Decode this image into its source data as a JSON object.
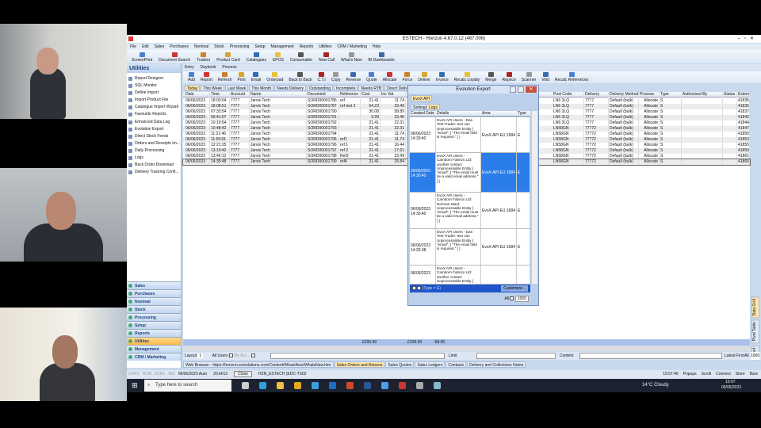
{
  "app": {
    "title": "ESTECH - Horizon 4.67.0.12 (467.006)"
  },
  "menu": [
    "File",
    "Edit",
    "Sales",
    "Purchases",
    "Nominal",
    "Stock",
    "Processing",
    "Setup",
    "Management",
    "Reports",
    "Utilities",
    "CRM / Marketing",
    "Help"
  ],
  "quickbar": [
    "ScreenPrint",
    "Document Search",
    "Traders",
    "Product Card",
    "Catalogues",
    "EPOS",
    "Consumable",
    "New Call",
    "What's New",
    "BI Dashboards"
  ],
  "subtabs": [
    "Entry",
    "Daybook",
    "Process"
  ],
  "actions": [
    "Add",
    "Report",
    "Refresh",
    "Print",
    "Email",
    "Orderpad",
    "Back to Back",
    "C.T.I",
    "Copy",
    "Reverse",
    "Quote",
    "Allocate",
    "Force",
    "Deliver",
    "Invoice",
    "Recalc Loyalty",
    "Merge",
    "Reprice",
    "Scanner",
    "Void",
    "Recalc References"
  ],
  "sidebar": {
    "title": "Utilities",
    "items": [
      "Report Designer",
      "SQL Monitor",
      "Define Import",
      "Import Product File",
      "Catalogue Import Wizard",
      "Favourite Reports",
      "Enhanced Data Log",
      "Evolution Export",
      "Direct Stock Feeds",
      "Orders and Receipts Im...",
      "Daily Processing",
      "Logs",
      "Back Order Download",
      "Delivery Tracking Confi..."
    ],
    "nav": [
      "Sales",
      "Purchases",
      "Nominal",
      "Stock",
      "Processing",
      "Setup",
      "Reports",
      "Utilities",
      "Management",
      "CRM / Marketing"
    ],
    "nav_selected": "Utilities"
  },
  "filters": [
    "Today",
    "This Week",
    "Last Week",
    "This Month",
    "Needs Delivery",
    "Outstanding",
    "Incomplete",
    "Needs RTB",
    "Direct Delivery O/S",
    "Search"
  ],
  "grid": {
    "left_columns": [
      "Date",
      "Time",
      "Account",
      "Name",
      "Document",
      "Reference",
      "Cost",
      "Inc Vat"
    ],
    "right_columns": [
      "Post Code",
      "Delivery",
      "Delivery Method",
      "Process",
      "Type",
      "Authorised By",
      "Status",
      "External I"
    ],
    "rows": [
      [
        "06/06/2023",
        "18:03:04",
        "7777",
        "Jarvis Tech",
        "SORD00001786",
        "ref",
        "21.41",
        "11.74",
        "LN6 3LQ",
        "7777",
        "Default (bulk)",
        "Allocate",
        "S",
        "",
        "",
        "4183571"
      ],
      [
        "06/06/2023",
        "18:08:51",
        "7777",
        "Jarvis Tech",
        "SORD00001787",
        "ref test 2",
        "64.23",
        "23.49",
        "LN6 3LQ",
        "7777",
        "Default (bulk)",
        "Allocate",
        "S",
        "",
        "",
        "4183577"
      ],
      [
        "06/06/2023",
        "07:33:54",
        "7777",
        "Jarvis Tech",
        "SORD00001790",
        "",
        "30.08",
        "58.89",
        "LN6 3LQ",
        "7777",
        "Default (bulk)",
        "Allocate",
        "S",
        "",
        "",
        "4183769"
      ],
      [
        "06/06/2023",
        "09:41:07",
        "7777",
        "Jarvis Tech",
        "SORD00001791",
        "",
        "9.99",
        "23.46",
        "LN6 3LQ",
        "7777",
        "Default (bulk)",
        "Allocate",
        "S",
        "",
        "",
        "4184243"
      ],
      [
        "06/06/2023",
        "10:16:54",
        "7777",
        "Jarvis Tech",
        "SORD00001792",
        "",
        "21.41",
        "22.31",
        "LN6 3LQ",
        "7777",
        "Default (bulk)",
        "Allocate",
        "S",
        "",
        "",
        "4184493"
      ],
      [
        "06/06/2023",
        "10:48:42",
        "7777",
        "Jarvis Tech",
        "SORD00001793",
        "",
        "21.41",
        "22.31",
        "LN58GN",
        "77772",
        "Default (bulk)",
        "Allocate",
        "S",
        "",
        "",
        "4184730"
      ],
      [
        "06/06/2023",
        "11:21:46",
        "7777",
        "Jarvis Tech",
        "SORD00001794",
        "",
        "21.41",
        "11.74",
        "LN58GN",
        "77772",
        "Default (bulk)",
        "Allocate",
        "S",
        "",
        "",
        "4185007"
      ],
      [
        "06/06/2023",
        "11:55:01",
        "7777",
        "Jarvis Tech",
        "SORD00001795",
        "ref1",
        "21.41",
        "11.74",
        "LN58GN",
        "77772",
        "Default (bulk)",
        "Allocate",
        "S",
        "",
        "",
        "4185317"
      ],
      [
        "06/06/2023",
        "12:21:25",
        "7777",
        "Jarvis Tech",
        "SORD00001796",
        "ref 1",
        "21.41",
        "16.44",
        "LN58GN",
        "77772",
        "Default (bulk)",
        "Allocate",
        "S",
        "",
        "",
        "4185525"
      ],
      [
        "06/06/2023",
        "13:10:42",
        "7777",
        "Jarvis Tech",
        "SORD00001797",
        "ref 2",
        "21.41",
        "17.61",
        "LN58GN",
        "77772",
        "Default (bulk)",
        "Allocate",
        "S",
        "",
        "",
        "4185935"
      ],
      [
        "06/06/2023",
        "13:46:12",
        "7777",
        "Jarvis Tech",
        "SORD00001798",
        "Ref3",
        "21.41",
        "23.49",
        "LN58GN",
        "77772",
        "Default (bulk)",
        "Allocate",
        "S",
        "",
        "",
        "4186151"
      ],
      [
        "06/06/2023",
        "14:35:48",
        "7777",
        "Jarvis Tech",
        "SORD00001799",
        "ref4",
        "21.41",
        "25.84",
        "LN58GN",
        "77772",
        "Default (bulk)",
        "Allocate",
        "S",
        "",
        "",
        "4186538"
      ]
    ],
    "totals": [
      "£296.99",
      "£228.99",
      "-68.00"
    ]
  },
  "dialog": {
    "title": "Evolution Export",
    "tab": "EvoX API",
    "subtabs": [
      "Settings",
      "Logs"
    ],
    "columns": [
      "Created Date",
      "Details",
      "Area",
      "Type"
    ],
    "rows": [
      {
        "date": "06/06/2023 14:30:40",
        "details": "EvoX API Users - Dan Test Trader: test can Unprocessable Entity { \"email\": [ \"The email field is required.\" ] }",
        "area": "EvoX API EU 1684",
        "type": "E"
      },
      {
        "date": "06/06/2023 14:30:40",
        "details": "EvoX API Users - Camborn Fabrics Ltd: another contact Unprocessable Entity { \"email\": [ \"The email must be a valid email address.\" ] }",
        "area": "EvoX API EU 1684",
        "type": "E"
      },
      {
        "date": "06/06/2023 14:30:40",
        "details": "EvoX API Users - Camborn Fabrics Ltd: Norman Ward Unprocessable Entity { \"email\": [ \"The email must be a valid email address.\" ] }",
        "area": "EvoX API EU 1684",
        "type": "E"
      },
      {
        "date": "06/06/2023 14:26:38",
        "details": "EvoX API Users - Dan Test Trader: test can Unprocessable Entity { \"email\": [ \"The email field is required.\" ] }",
        "area": "EvoX API EU 1684",
        "type": "E"
      },
      {
        "date": "06/06/2023",
        "details": "EvoX API Users - Camborn Fabrics Ltd: another contact Unprocessable Entity {",
        "area": "",
        "type": ""
      }
    ],
    "filter": "(Type = E)",
    "customize": "Customize...",
    "all_label": "All",
    "count": "1000"
  },
  "bottom": {
    "layout_label": "Layout",
    "layout_value": "1",
    "all_users": "All Users",
    "my_acc": "My Acc...",
    "limit": "Limit",
    "content": "Content",
    "latest_first": "Latest First",
    "all": "All",
    "count": "1000"
  },
  "doc_tabs": [
    "Web Browser - https://horizon.ecisolutions.com/Content/WhatsNew/WhatsNew.htm",
    "Sales Orders and Returns",
    "Sales Quotes",
    "Sales Ledgers",
    "Contacts",
    "Delivery and Collections Notes"
  ],
  "side_tabs": [
    "Chart",
    "Pivot Table",
    "Data Grid"
  ],
  "status": {
    "keys": [
      "CAPS",
      "NUM",
      "SCRL",
      "INS"
    ],
    "date": "06/06/2023 Auto",
    "period": "2014/12",
    "close": "Close",
    "db": "HZN_ESTECH (EDC-TS02",
    "time": "15:07:46",
    "popups": "Popups",
    "scroll": "Scroll",
    "connect": "Connect",
    "store": "Store",
    "bars": "Bars"
  },
  "taskbar": {
    "search_placeholder": "Type here to search",
    "weather": "14°C  Cloudy",
    "time": "15:07",
    "date": "06/06/2023"
  }
}
